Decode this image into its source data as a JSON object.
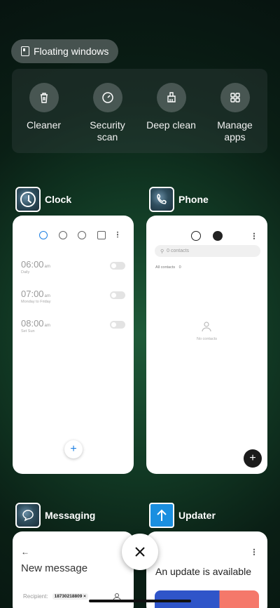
{
  "floating_windows": {
    "label": "Floating windows",
    "icon": "floating-window-icon"
  },
  "quick_actions": [
    {
      "label": "Cleaner",
      "icon": "trash-icon"
    },
    {
      "label": "Security\nscan",
      "icon": "speedometer-icon"
    },
    {
      "label": "Deep clean",
      "icon": "broom-icon"
    },
    {
      "label": "Manage\napps",
      "icon": "grid-icon"
    }
  ],
  "apps": {
    "clock": {
      "name": "Clock",
      "alarms": [
        {
          "time": "06:00",
          "ampm": "am",
          "repeat": "Daily"
        },
        {
          "time": "07:00",
          "ampm": "am",
          "repeat": "Monday to Friday"
        },
        {
          "time": "08:00",
          "ampm": "am",
          "repeat": "Set Sun"
        }
      ]
    },
    "phone": {
      "name": "Phone",
      "search_placeholder": "0 contacts",
      "all_contacts_label": "All contacts",
      "all_contacts_count": "0",
      "empty_label": "No contacts"
    },
    "messaging": {
      "name": "Messaging",
      "title": "New message",
      "recipient_label": "Recipient:",
      "recipient_value": "18730218809"
    },
    "updater": {
      "name": "Updater",
      "title": "An update is available"
    }
  },
  "colors": {
    "accent_blue": "#1d7fe2",
    "updater_blue": "#2f55c9",
    "updater_coral": "#f5786a"
  }
}
